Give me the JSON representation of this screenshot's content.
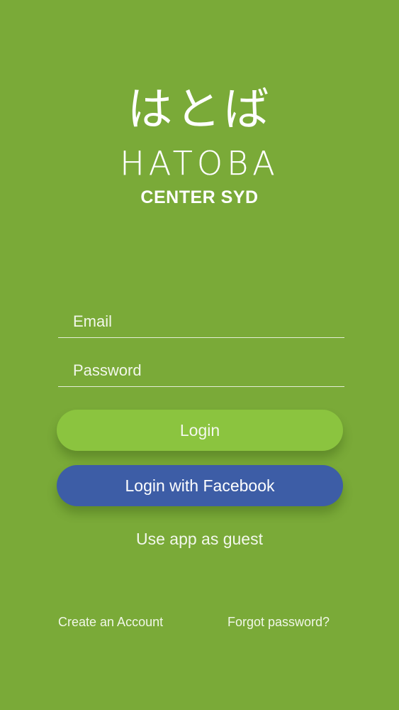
{
  "brand": {
    "japanese": "はとば",
    "name": "HATOBA",
    "subtitle": "CENTER SYD"
  },
  "form": {
    "email": {
      "value": "",
      "placeholder": "Email"
    },
    "password": {
      "value": "",
      "placeholder": "Password"
    }
  },
  "buttons": {
    "login": "Login",
    "facebook": "Login with Facebook"
  },
  "links": {
    "guest": "Use app as guest",
    "create_account": "Create an Account",
    "forgot_password": "Forgot password?"
  },
  "colors": {
    "background": "#7aaa38",
    "login_button": "#8bc43f",
    "facebook_button": "#3d5da6",
    "text": "#ffffff"
  }
}
